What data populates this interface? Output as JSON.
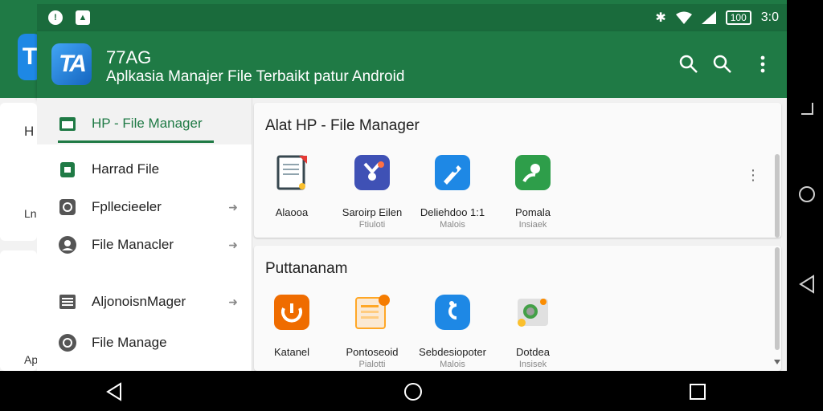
{
  "status_bar": {
    "battery": "100",
    "time": "3:0"
  },
  "app_bar": {
    "logo_text": "TA",
    "title": "77AG",
    "subtitle": "Aplkasia Manajer File Terbaikt patur Android",
    "actions": [
      "search-icon",
      "search-icon",
      "more-vert-icon"
    ]
  },
  "background_app": {
    "logo_text": "T",
    "text_1": "H",
    "text_2": "Lnl",
    "text_3": "Ap"
  },
  "drawer": {
    "header_label": "HP - File Manager",
    "items": [
      {
        "label": "Harrad File",
        "icon": "file-icon",
        "arrow": ""
      },
      {
        "label": "Fpllecieeler",
        "icon": "circle-arrow-icon",
        "arrow": "➜"
      },
      {
        "label": "File Manacler",
        "icon": "user-icon",
        "arrow": "➜"
      },
      {
        "label": "AljonoisnMager",
        "icon": "list-icon",
        "arrow": "➜"
      },
      {
        "label": "File Manage",
        "icon": "circle-arrow-icon",
        "arrow": ""
      }
    ]
  },
  "sections": [
    {
      "title": "Alat HP - File Manager",
      "tools": [
        {
          "name": "Alaooa",
          "sub": "",
          "icon": "document-icon",
          "color": "#ffffff"
        },
        {
          "name": "Saroirp Eilen",
          "sub": "Ftiuloti",
          "icon": "shield-icon",
          "color": "#3f51b5"
        },
        {
          "name": "Deliehdoo 1:1",
          "sub": "Malois",
          "icon": "edit-icon",
          "color": "#1e88e5"
        },
        {
          "name": "Pomala",
          "sub": "Insiaek",
          "icon": "chat-icon",
          "color": "#2e9e4a"
        }
      ]
    },
    {
      "title": "Puttananam",
      "tools": [
        {
          "name": "Katanel",
          "sub": "",
          "icon": "timer-icon",
          "color": "#ef6c00"
        },
        {
          "name": "Pontoseoid",
          "sub": "Pialotti",
          "icon": "notes-icon",
          "color": "#f5e7d3"
        },
        {
          "name": "Sebdesiopoter",
          "sub": "Malois",
          "icon": "transfer-icon",
          "color": "#1e88e5"
        },
        {
          "name": "Dotdea",
          "sub": "Insisek",
          "icon": "photo-icon",
          "color": "#e8e8e8"
        }
      ]
    }
  ],
  "colors": {
    "primary": "#1f7a45",
    "status_bar": "#1a6b3c"
  }
}
